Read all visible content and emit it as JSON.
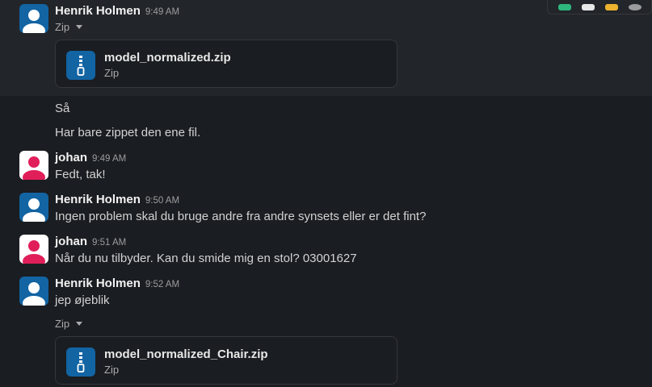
{
  "toolbar": {
    "icons": [
      "check-mark-icon",
      "eyes-icon",
      "raised-hands-icon",
      "add-reaction-icon"
    ]
  },
  "messages": [
    {
      "author": "Henrik Holmen",
      "time": "9:49 AM",
      "avatar_color": "#1264a3",
      "file_group_label": "Zip",
      "file": {
        "name": "model_normalized.zip",
        "type": "Zip"
      }
    },
    {
      "text": "Så"
    },
    {
      "text": "Har bare zippet den ene fil."
    },
    {
      "author": "johan",
      "time": "9:49 AM",
      "avatar_color": "#e01e5a",
      "text": "Fedt, tak!"
    },
    {
      "author": "Henrik Holmen",
      "time": "9:50 AM",
      "avatar_color": "#1264a3",
      "text": "Ingen problem skal du bruge andre fra andre synsets eller er det fint?"
    },
    {
      "author": "johan",
      "time": "9:51 AM",
      "avatar_color": "#e01e5a",
      "text": "Når du nu tilbyder. Kan du smide mig en stol? 03001627"
    },
    {
      "author": "Henrik Holmen",
      "time": "9:52 AM",
      "avatar_color": "#1264a3",
      "text": "jep øjeblik",
      "file_group_label": "Zip",
      "file": {
        "name": "model_normalized_Chair.zip",
        "type": "Zip"
      }
    }
  ]
}
